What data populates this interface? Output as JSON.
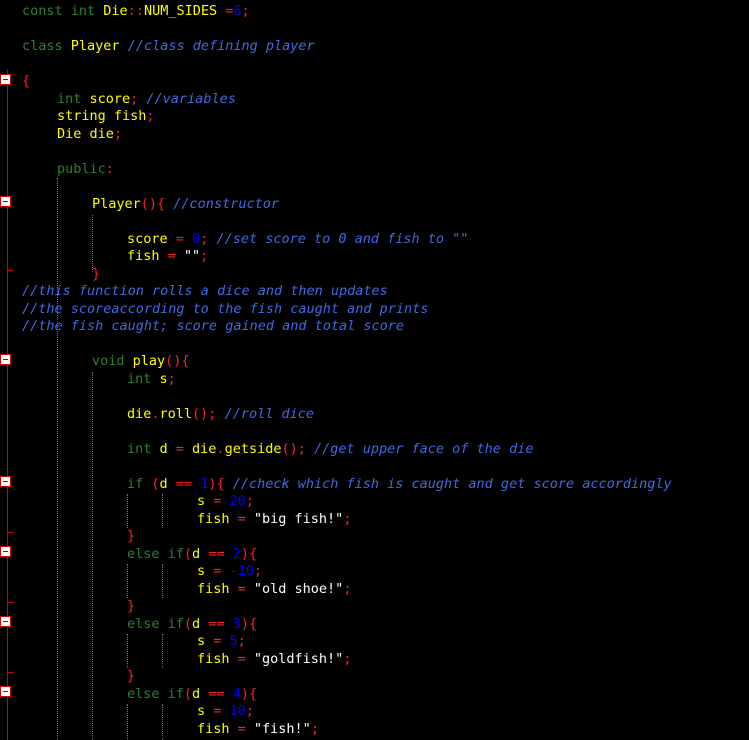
{
  "colors": {
    "background": "#000000",
    "keyword": "#2f7f2f",
    "identifier": "#ffff00",
    "operator": "#ff2020",
    "number": "#0000ff",
    "comment": "#4169e1",
    "string": "#ffffff",
    "fold_marker": "#cc0000"
  },
  "code": {
    "l1": {
      "a": "const int ",
      "b": "Die",
      "c": "::",
      "d": "NUM_SIDES",
      "e": " =",
      "f": "6",
      "g": ";"
    },
    "l2": {
      "a": "class ",
      "b": "Player",
      "c": " //class defining player"
    },
    "l3": {
      "a": "{"
    },
    "l4": {
      "a": "int ",
      "b": "score",
      "c": ";",
      "d": " //variables"
    },
    "l5": {
      "a": "string fish",
      "b": ";"
    },
    "l6": {
      "a": "Die die",
      "b": ";"
    },
    "l7": {
      "a": "public",
      "b": ":"
    },
    "l8": {
      "a": "Player",
      "b": "(){",
      "c": " //constructor"
    },
    "l9": {
      "a": "score ",
      "b": "=",
      "c": " 0",
      "d": ";",
      "e": " //set score to 0 and fish to \"\""
    },
    "l10": {
      "a": "fish ",
      "b": "=",
      "c": " \"\"",
      "d": ";"
    },
    "l11": {
      "a": "}"
    },
    "l12": {
      "a": "//this function rolls a dice and then updates"
    },
    "l13": {
      "a": "//the scoreaccording to the fish caught and prints"
    },
    "l14": {
      "a": "//the fish caught; score gained and total score"
    },
    "l15": {
      "a": "void ",
      "b": "play",
      "c": "(){"
    },
    "l16": {
      "a": "int ",
      "b": "s",
      "c": ";"
    },
    "l17": {
      "a": "die",
      "b": ".",
      "c": "roll",
      "d": "();",
      "e": " //roll dice"
    },
    "l18": {
      "a": "int ",
      "b": "d ",
      "c": "=",
      "d": " die",
      "e": ".",
      "f": "getside",
      "g": "();",
      "h": " //get upper face of the die"
    },
    "l19": {
      "a": "if ",
      "b": "(",
      "c": "d ",
      "d": "==",
      "e": " 1",
      "f": "){",
      "g": " //check which fish is caught and get score accordingly"
    },
    "l20": {
      "a": "s ",
      "b": "=",
      "c": " 20",
      "d": ";"
    },
    "l21": {
      "a": "fish ",
      "b": "=",
      "c": " \"big fish!\"",
      "d": ";"
    },
    "l22": {
      "a": "}"
    },
    "l23": {
      "a": "else if",
      "b": "(",
      "c": "d ",
      "d": "==",
      "e": " 2",
      "f": "){"
    },
    "l24": {
      "a": "s ",
      "b": "=",
      "c": " -10",
      "d": ";"
    },
    "l25": {
      "a": "fish ",
      "b": "=",
      "c": " \"old shoe!\"",
      "d": ";"
    },
    "l26": {
      "a": "}"
    },
    "l27": {
      "a": "else if",
      "b": "(",
      "c": "d ",
      "d": "==",
      "e": " 3",
      "f": "){"
    },
    "l28": {
      "a": "s ",
      "b": "=",
      "c": " 5",
      "d": ";"
    },
    "l29": {
      "a": "fish ",
      "b": "=",
      "c": " \"goldfish!\"",
      "d": ";"
    },
    "l30": {
      "a": "}"
    },
    "l31": {
      "a": "else if",
      "b": "(",
      "c": "d ",
      "d": "==",
      "e": " 4",
      "f": "){"
    },
    "l32": {
      "a": "s ",
      "b": "=",
      "c": " 10",
      "d": ";"
    },
    "l33": {
      "a": "fish ",
      "b": "=",
      "c": " \"fish!\"",
      "d": ";"
    }
  }
}
